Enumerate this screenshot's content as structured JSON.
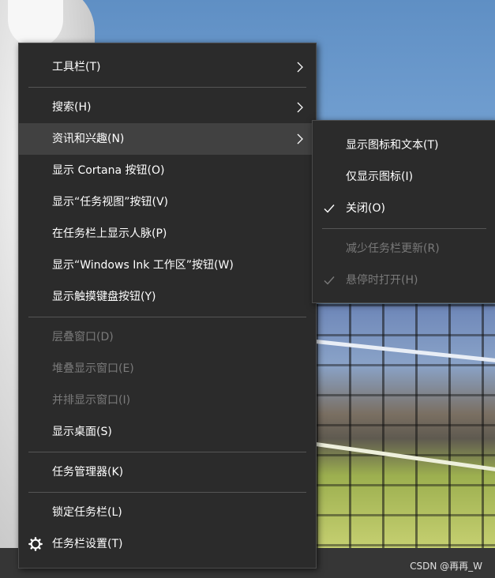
{
  "taskbar_menu": {
    "items": [
      {
        "label": "工具栏(T)"
      },
      {
        "label": "搜索(H)"
      },
      {
        "label": "资讯和兴趣(N)"
      },
      {
        "label": "显示 Cortana 按钮(O)"
      },
      {
        "label": "显示“任务视图”按钮(V)"
      },
      {
        "label": "在任务栏上显示人脉(P)"
      },
      {
        "label": "显示“Windows Ink 工作区”按钮(W)"
      },
      {
        "label": "显示触摸键盘按钮(Y)"
      },
      {
        "label": "层叠窗口(D)"
      },
      {
        "label": "堆叠显示窗口(E)"
      },
      {
        "label": "并排显示窗口(I)"
      },
      {
        "label": "显示桌面(S)"
      },
      {
        "label": "任务管理器(K)"
      },
      {
        "label": "锁定任务栏(L)"
      },
      {
        "label": "任务栏设置(T)"
      }
    ]
  },
  "news_submenu": {
    "items": [
      {
        "label": "显示图标和文本(T)"
      },
      {
        "label": "仅显示图标(I)"
      },
      {
        "label": "关闭(O)",
        "checked": true
      },
      {
        "label": "减少任务栏更新(R)"
      },
      {
        "label": "悬停时打开(H)",
        "checked": true
      }
    ]
  },
  "watermark": "CSDN @再再_W",
  "icons": {
    "submenu_arrow": "chevron-right-icon",
    "settings": "gear-icon",
    "check": "checkmark-icon"
  },
  "colors": {
    "menu_bg": "#2b2b2b",
    "hover_bg": "#414141",
    "text": "#ffffff",
    "disabled_text": "#7a7a7a",
    "separator": "#555555"
  }
}
